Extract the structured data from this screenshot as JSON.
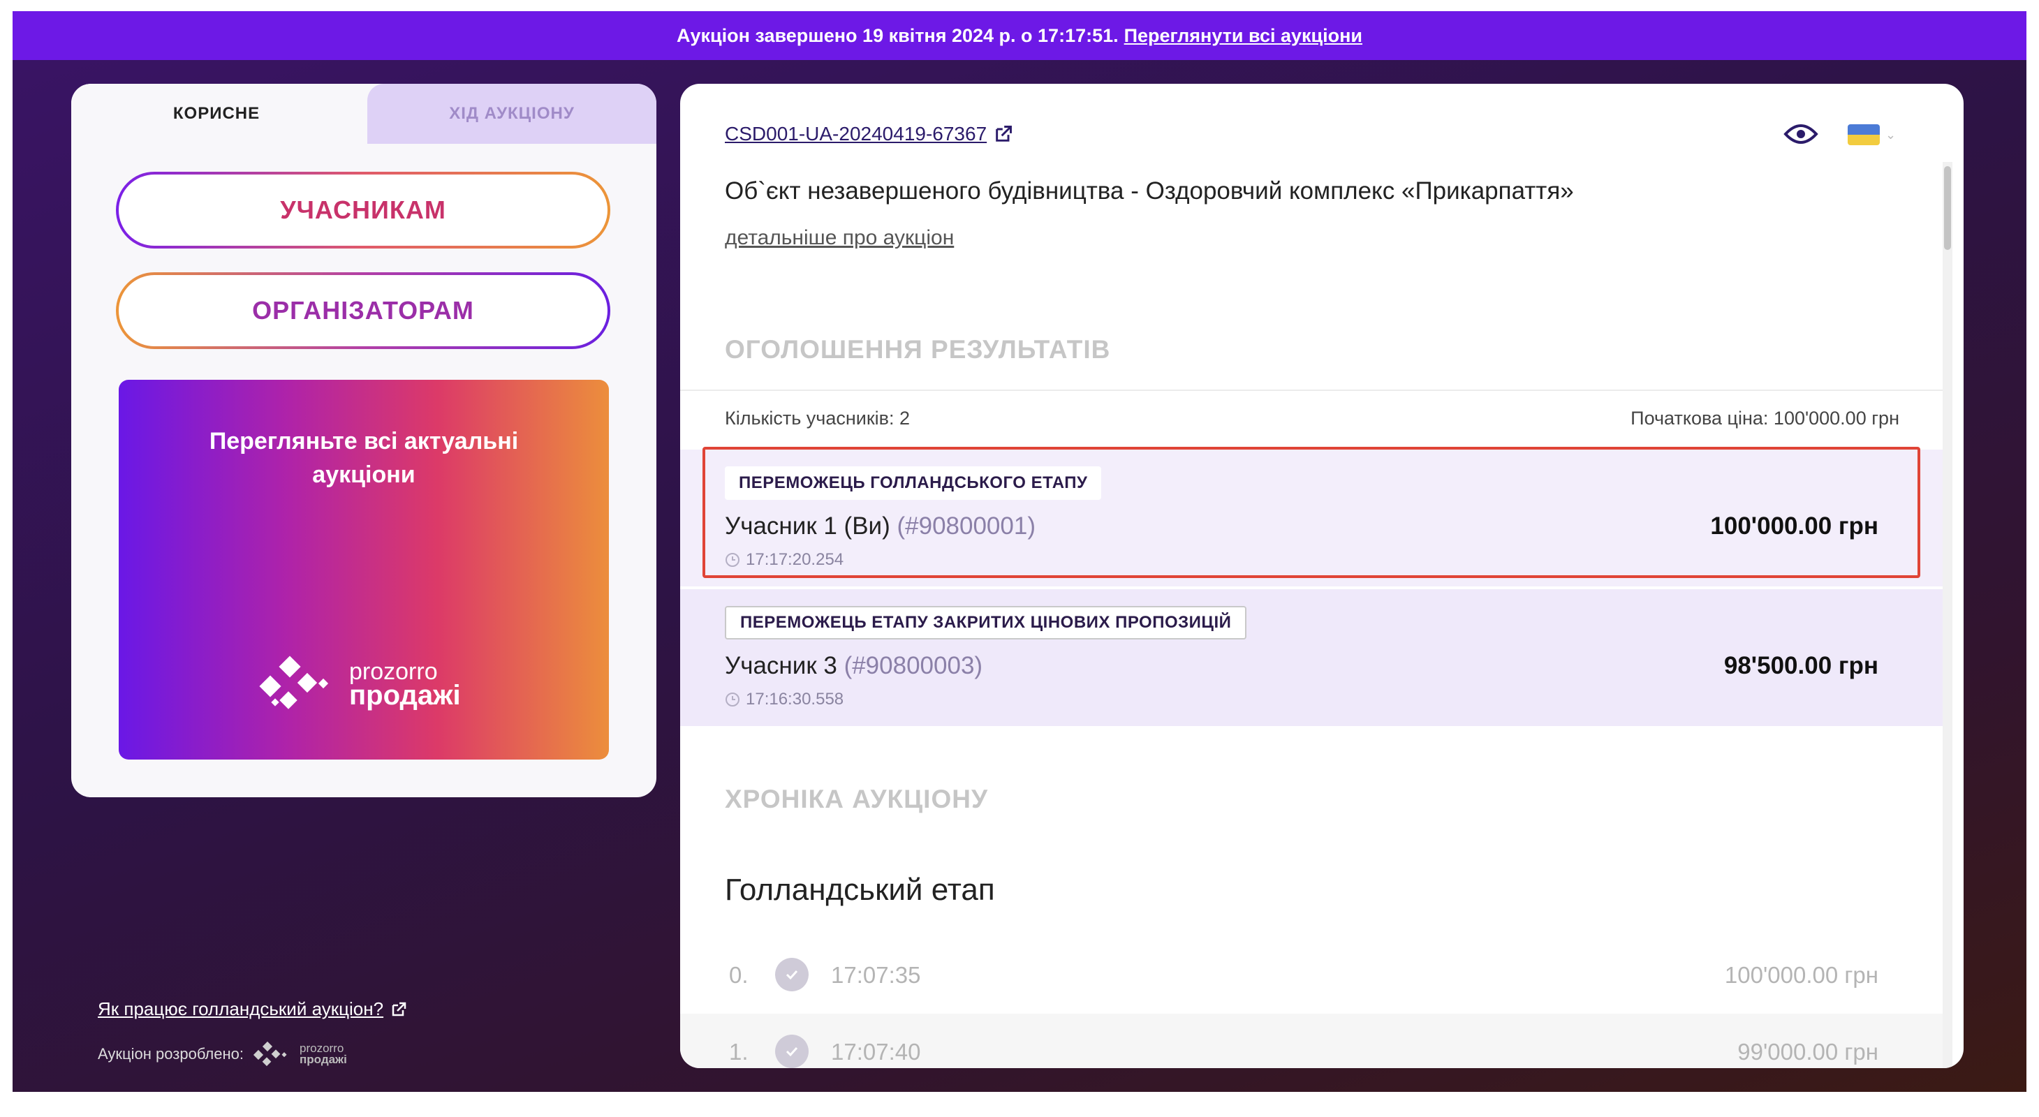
{
  "banner": {
    "text": "Аукціон завершено 19 квітня 2024 р. о 17:17:51.",
    "link": "Переглянути всі аукціони"
  },
  "left": {
    "tabs": [
      {
        "label": "КОРИСНЕ",
        "active": true
      },
      {
        "label": "ХІД АУКЦІОНУ",
        "active": false
      }
    ],
    "buttons": {
      "participants": "УЧАСНИКАМ",
      "organizers": "ОРГАНІЗАТОРАМ"
    },
    "promo": {
      "title": "Перегляньте всі актуальні аукціони",
      "logo_line1": "prozorro",
      "logo_line2": "продажі"
    },
    "how_link": "Як працює голландський аукціон?",
    "developed_by": "Аукціон розроблено:",
    "dev_logo_line1": "prozorro",
    "dev_logo_line2": "продажі"
  },
  "right": {
    "auction_id": "CSD001-UA-20240419-67367",
    "object_title": "Об`єкт незавершеного будівництва - Оздоровчий комплекс «Прикарпаття»",
    "details_link": "детальніше про аукціон",
    "results_header": "ОГОЛОШЕННЯ РЕЗУЛЬТАТІВ",
    "participants_count": "Кількість учасників: 2",
    "start_price": "Початкова ціна: 100'000.00 грн",
    "results": [
      {
        "badge": "ПЕРЕМОЖЕЦЬ ГОЛЛАНДСЬКОГО ЕТАПУ",
        "name": "Учасник 1 (Ви)",
        "id": "(#90800001)",
        "time": "17:17:20.254",
        "price": "100'000.00 грн"
      },
      {
        "badge": "ПЕРЕМОЖЕЦЬ ЕТАПУ ЗАКРИТИХ ЦІНОВИХ ПРОПОЗИЦІЙ",
        "name": "Учасник 3",
        "id": "(#90800003)",
        "time": "17:16:30.558",
        "price": "98'500.00 грн"
      }
    ],
    "chronicle_header": "ХРОНІКА АУКЦІОНУ",
    "stage_title": "Голландський етап",
    "timeline": [
      {
        "index": "0.",
        "time": "17:07:35",
        "price": "100'000.00 грн"
      },
      {
        "index": "1.",
        "time": "17:07:40",
        "price": "99'000.00 грн"
      }
    ]
  },
  "colors": {
    "banner": "#6d19e6",
    "highlight_border": "#e04436",
    "result_bg": "#f3eefb"
  },
  "icons": [
    "external-link-icon",
    "eye-icon",
    "ukraine-flag-icon",
    "chevron-down-icon",
    "clock-icon",
    "check-icon",
    "prozorro-logo"
  ]
}
